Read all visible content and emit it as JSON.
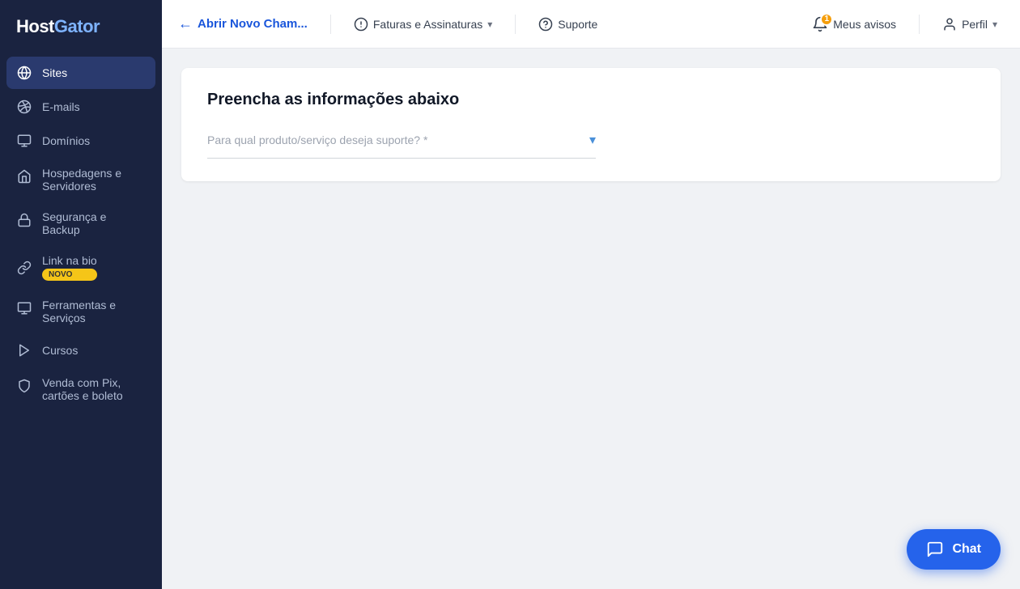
{
  "brand": {
    "name_part1": "Host",
    "name_part2": "Gator"
  },
  "sidebar": {
    "items": [
      {
        "id": "sites",
        "label": "Sites",
        "active": true
      },
      {
        "id": "emails",
        "label": "E-mails",
        "active": false
      },
      {
        "id": "dominios",
        "label": "Domínios",
        "active": false
      },
      {
        "id": "hospedagens",
        "label": "Hospedagens e Servidores",
        "active": false,
        "multiline": true
      },
      {
        "id": "seguranca",
        "label": "Segurança e Backup",
        "active": false,
        "multiline": true
      },
      {
        "id": "link-bio",
        "label": "Link na bio",
        "active": false,
        "badge": "NOVO"
      },
      {
        "id": "ferramentas",
        "label": "Ferramentas e Serviços",
        "active": false,
        "multiline": true
      },
      {
        "id": "cursos",
        "label": "Cursos",
        "active": false
      },
      {
        "id": "venda-pix",
        "label": "Venda com Pix, cartões e boleto",
        "active": false,
        "multiline": true
      }
    ]
  },
  "topnav": {
    "back_label": "Abrir Novo Cham...",
    "billing_label": "Faturas e Assinaturas",
    "support_label": "Suporte",
    "notifications_label": "Meus avisos",
    "notification_count": "1",
    "profile_label": "Perfil"
  },
  "form": {
    "title": "Preencha as informações abaixo",
    "select_placeholder": "Para qual produto/serviço deseja suporte? *"
  },
  "chat": {
    "label": "Chat"
  }
}
